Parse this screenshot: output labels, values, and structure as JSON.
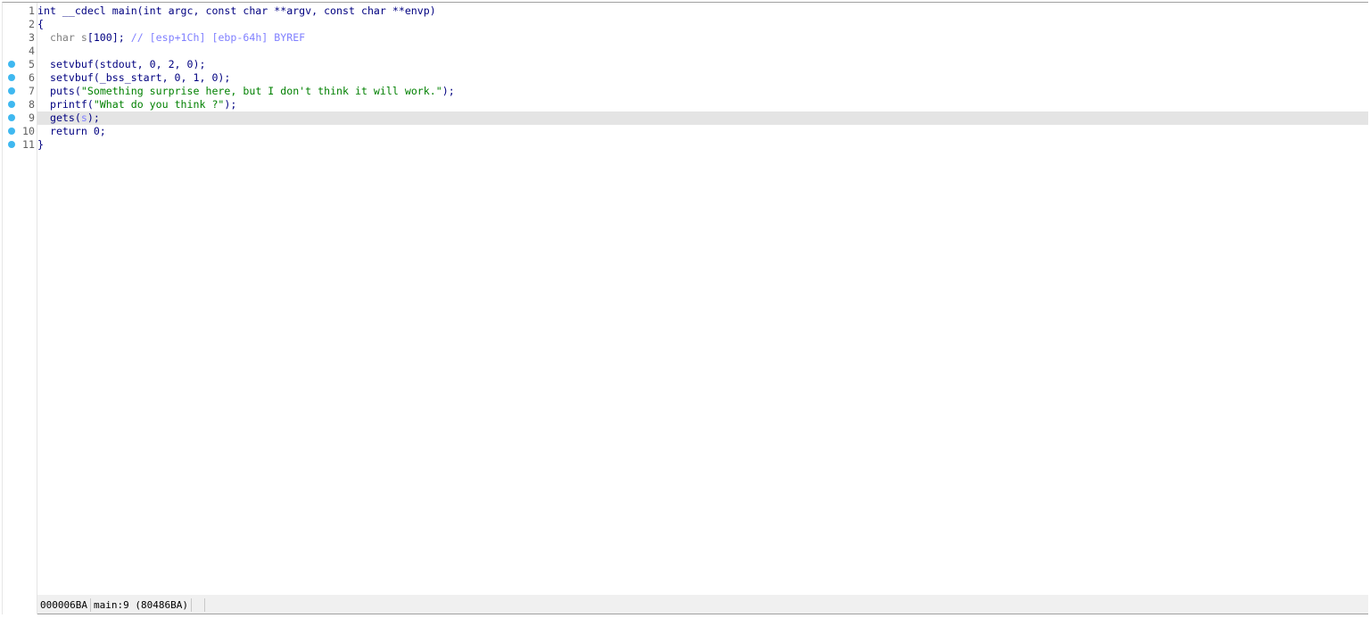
{
  "editor": {
    "current_line": 9,
    "breakpoint_color": "#3fb8f0",
    "lines": [
      {
        "num": "1",
        "dot": false,
        "tokens": [
          {
            "t": "kw",
            "s": "int __cdecl main(int argc, const char **argv, const char **envp)"
          }
        ]
      },
      {
        "num": "2",
        "dot": false,
        "tokens": [
          {
            "t": "kw",
            "s": "{"
          }
        ]
      },
      {
        "num": "3",
        "dot": false,
        "tokens": [
          {
            "t": "gray",
            "s": "  char s"
          },
          {
            "t": "kw",
            "s": "[100]; "
          },
          {
            "t": "cmt",
            "s": "// [esp+1Ch] [ebp-64h] BYREF"
          }
        ]
      },
      {
        "num": "4",
        "dot": false,
        "tokens": []
      },
      {
        "num": "5",
        "dot": true,
        "tokens": [
          {
            "t": "kw",
            "s": "  setvbuf(stdout, 0, 2, 0);"
          }
        ]
      },
      {
        "num": "6",
        "dot": true,
        "tokens": [
          {
            "t": "kw",
            "s": "  setvbuf(_bss_start, 0, 1, 0);"
          }
        ]
      },
      {
        "num": "7",
        "dot": true,
        "tokens": [
          {
            "t": "kw",
            "s": "  puts("
          },
          {
            "t": "str",
            "s": "\"Something surprise here, but I don't think it will work.\""
          },
          {
            "t": "kw",
            "s": ");"
          }
        ]
      },
      {
        "num": "8",
        "dot": true,
        "tokens": [
          {
            "t": "kw",
            "s": "  printf("
          },
          {
            "t": "str",
            "s": "\"What do you think ?\""
          },
          {
            "t": "kw",
            "s": ");"
          }
        ]
      },
      {
        "num": "9",
        "dot": true,
        "tokens": [
          {
            "t": "kw",
            "s": "  gets("
          },
          {
            "t": "var",
            "s": "s"
          },
          {
            "t": "kw",
            "s": ");"
          }
        ]
      },
      {
        "num": "10",
        "dot": true,
        "tokens": [
          {
            "t": "kw",
            "s": "  return 0;"
          }
        ]
      },
      {
        "num": "11",
        "dot": true,
        "tokens": [
          {
            "t": "kw",
            "s": "}"
          }
        ]
      }
    ]
  },
  "status": {
    "offset": "000006BA",
    "location": "main:9 (80486BA)"
  }
}
